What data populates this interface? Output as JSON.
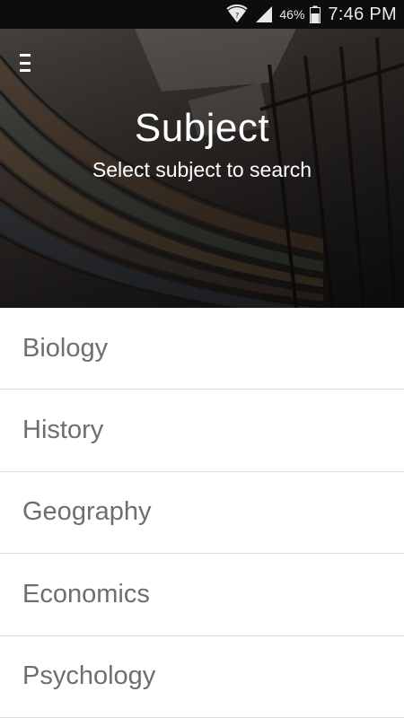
{
  "status_bar": {
    "battery_percent": "46%",
    "time": "7:46 PM",
    "icons": [
      "wifi-icon",
      "signal-icon",
      "battery-icon"
    ]
  },
  "header": {
    "menu_icon": "hamburger-menu-icon",
    "title": "Subject",
    "subtitle": "Select subject to search",
    "background": "library-bookshelves-photo"
  },
  "subjects": [
    {
      "label": "Biology"
    },
    {
      "label": "History"
    },
    {
      "label": "Geography"
    },
    {
      "label": "Economics"
    },
    {
      "label": "Psychology"
    }
  ],
  "colors": {
    "status_bar_bg": "#0d0d0d",
    "header_overlay": "#1c1a1a",
    "list_text": "#6e6e6e",
    "divider": "#dcdcdc"
  }
}
